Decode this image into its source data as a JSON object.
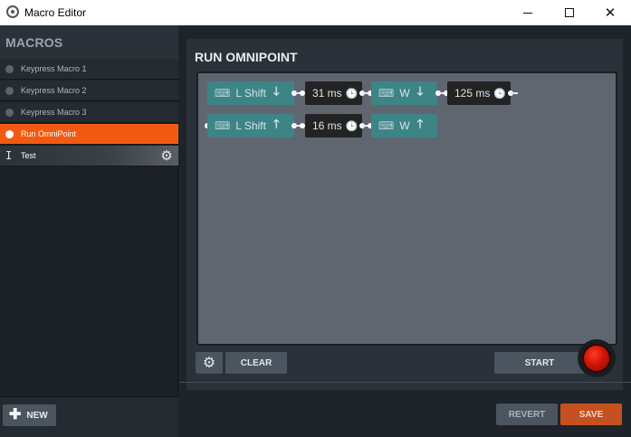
{
  "window": {
    "title": "Macro Editor",
    "controls": {
      "minimize": "",
      "maximize": "",
      "close": "✕"
    }
  },
  "sidebar": {
    "title": "MACROS",
    "items": [
      {
        "label": "Keypress Macro 1",
        "state": "normal"
      },
      {
        "label": "Keypress Macro 2",
        "state": "normal"
      },
      {
        "label": "Keypress Macro 3",
        "state": "normal"
      },
      {
        "label": "Run OmniPoint",
        "state": "active"
      },
      {
        "label": "Test",
        "state": "editing"
      }
    ],
    "new_button": {
      "icon": "plus-icon",
      "label": "NEW"
    }
  },
  "editor": {
    "title": "RUN OMNIPOINT",
    "sequence": [
      [
        {
          "type": "key",
          "icon": "keyboard-icon",
          "key": "L Shift",
          "direction": "down",
          "arrow": "🡓"
        },
        {
          "type": "delay",
          "value": "31 ms",
          "icon": "clock-icon"
        },
        {
          "type": "key",
          "icon": "keyboard-icon",
          "key": "W",
          "direction": "down",
          "arrow": "🡓"
        },
        {
          "type": "delay",
          "value": "125 ms",
          "icon": "clock-icon"
        }
      ],
      [
        {
          "type": "key",
          "icon": "keyboard-icon",
          "key": "L Shift",
          "direction": "up",
          "arrow": "🡑"
        },
        {
          "type": "delay",
          "value": "16 ms",
          "icon": "clock-icon"
        },
        {
          "type": "key",
          "icon": "keyboard-icon",
          "key": "W",
          "direction": "up",
          "arrow": "🡑"
        }
      ]
    ],
    "toolbar": {
      "settings_icon": "gear-icon",
      "clear_label": "CLEAR",
      "start_label": "START",
      "record_icon": "record-icon"
    }
  },
  "footer": {
    "revert_label": "REVERT",
    "save_label": "SAVE"
  },
  "colors": {
    "accent": "#f25a12",
    "key_chip": "#3d8486",
    "delay_chip": "#232323",
    "save": "#c4511f"
  },
  "glyphs": {
    "gear": "⚙",
    "keyboard": "⌨",
    "clock": "🕒",
    "cursor": "I",
    "plus": "✚"
  }
}
